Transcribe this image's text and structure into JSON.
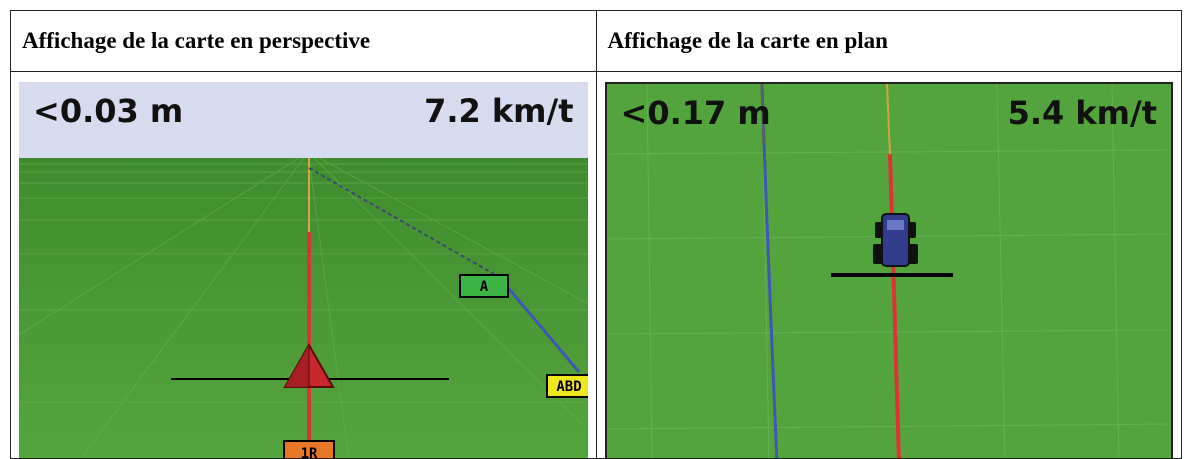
{
  "panels": [
    {
      "heading": "Affichage de la carte en perspective",
      "view": "perspective",
      "offline_distance": "<0.03 m",
      "speed": "7.2 km/t",
      "markers": {
        "point_a": "A",
        "swath_label": "ABD",
        "swath_number": "1R"
      }
    },
    {
      "heading": "Affichage de la carte en plan",
      "view": "plan",
      "offline_distance": "<0.17 m",
      "speed": "5.4 km/t"
    }
  ],
  "colors": {
    "field_green": "#4f9d3a",
    "sky": "#d7dbef",
    "guidance_line": "#e03232",
    "swath_line": "#3c5ab4",
    "vehicle_triangle": "#c8282d",
    "vehicle_plan": "#323c8c",
    "marker_a": "#3cb446",
    "marker_abd": "#f0e61e",
    "marker_swath": "#e67828"
  },
  "icons": {
    "vehicle_perspective": "vehicle-triangle-icon",
    "vehicle_plan": "tractor-icon"
  }
}
